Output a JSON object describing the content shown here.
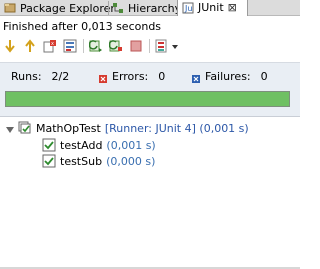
{
  "tabs": [
    {
      "label": "Package Explorer",
      "icon": "package-explorer-icon",
      "active": false
    },
    {
      "label": "Hierarchy",
      "icon": "hierarchy-icon",
      "active": false
    },
    {
      "label": "JUnit",
      "icon": "junit-icon",
      "active": true,
      "close": "⊠"
    }
  ],
  "status": "Finished after 0,013 seconds",
  "toolbar": {
    "icons": [
      "next-failure-icon",
      "previous-failure-icon",
      "show-failures-only-icon",
      "scroll-lock-icon",
      "rerun-icon",
      "rerun-failed-first-icon",
      "stop-icon",
      "history-icon",
      "view-menu-icon"
    ]
  },
  "counters": {
    "runs_label": "Runs:",
    "runs_value": "2/2",
    "errors_label": "Errors:",
    "errors_value": "0",
    "failures_label": "Failures:",
    "failures_value": "0"
  },
  "progress": {
    "fraction": 1.0,
    "color": "#6fc063"
  },
  "tree": {
    "root": {
      "name": "MathOpTest",
      "detail": "[Runner: JUnit 4] (0,001 s)"
    },
    "children": [
      {
        "name": "testAdd",
        "detail": "(0,001 s)"
      },
      {
        "name": "testSub",
        "detail": "(0,000 s)"
      }
    ]
  }
}
